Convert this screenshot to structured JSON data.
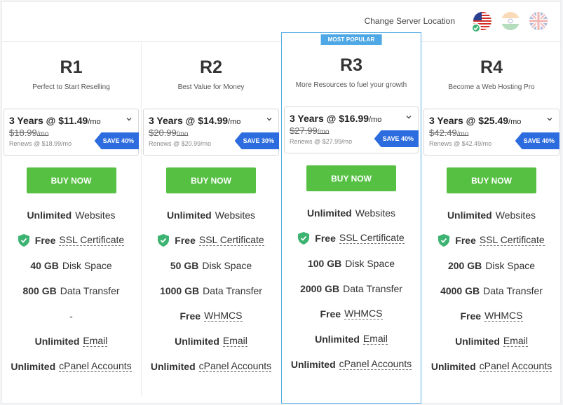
{
  "location": {
    "label": "Change Server Location",
    "flags": [
      {
        "name": "us-flag-icon",
        "selected": true
      },
      {
        "name": "india-flag-icon",
        "selected": false
      },
      {
        "name": "uk-flag-icon",
        "selected": false
      }
    ]
  },
  "plans": [
    {
      "name": "R1",
      "tagline": "Perfect to Start Reselling",
      "term": "3 Years @ $11.49",
      "per": "/mo",
      "old_price": "$18.99",
      "renews": "Renews @ $18.99/mo",
      "save": "SAVE 40%",
      "buy": "BUY NOW",
      "features": {
        "websites_bold": "Unlimited",
        "websites": "Websites",
        "ssl_bold": "Free",
        "ssl": "SSL Certificate",
        "disk_bold": "40 GB",
        "disk": "Disk Space",
        "transfer_bold": "800 GB",
        "transfer": "Data Transfer",
        "whmcs_bold": "",
        "whmcs": "-",
        "email_bold": "Unlimited",
        "email": "Email",
        "cpanel_bold": "Unlimited",
        "cpanel": "cPanel Accounts"
      }
    },
    {
      "name": "R2",
      "tagline": "Best Value for Money",
      "term": "3 Years @ $14.99",
      "per": "/mo",
      "old_price": "$20.99",
      "renews": "Renews @ $20.99/mo",
      "save": "SAVE 30%",
      "buy": "BUY NOW",
      "features": {
        "websites_bold": "Unlimited",
        "websites": "Websites",
        "ssl_bold": "Free",
        "ssl": "SSL Certificate",
        "disk_bold": "50 GB",
        "disk": "Disk Space",
        "transfer_bold": "1000 GB",
        "transfer": "Data Transfer",
        "whmcs_bold": "Free",
        "whmcs": "WHMCS",
        "email_bold": "Unlimited",
        "email": "Email",
        "cpanel_bold": "Unlimited",
        "cpanel": "cPanel Accounts"
      }
    },
    {
      "name": "R3",
      "tagline": "More Resources to fuel your growth",
      "popular": "MOST POPULAR",
      "term": "3 Years @ $16.99",
      "per": "/mo",
      "old_price": "$27.99",
      "renews": "Renews @ $27.99/mo",
      "save": "SAVE 40%",
      "buy": "BUY NOW",
      "features": {
        "websites_bold": "Unlimited",
        "websites": "Websites",
        "ssl_bold": "Free",
        "ssl": "SSL Certificate",
        "disk_bold": "100 GB",
        "disk": "Disk Space",
        "transfer_bold": "2000 GB",
        "transfer": "Data Transfer",
        "whmcs_bold": "Free",
        "whmcs": "WHMCS",
        "email_bold": "Unlimited",
        "email": "Email",
        "cpanel_bold": "Unlimited",
        "cpanel": "cPanel Accounts"
      }
    },
    {
      "name": "R4",
      "tagline": "Become a Web Hosting Pro",
      "term": "3 Years @ $25.49",
      "per": "/mo",
      "old_price": "$42.49",
      "renews": "Renews @ $42.49/mo",
      "save": "SAVE 40%",
      "buy": "BUY NOW",
      "features": {
        "websites_bold": "Unlimited",
        "websites": "Websites",
        "ssl_bold": "Free",
        "ssl": "SSL Certificate",
        "disk_bold": "200 GB",
        "disk": "Disk Space",
        "transfer_bold": "4000 GB",
        "transfer": "Data Transfer",
        "whmcs_bold": "Free",
        "whmcs": "WHMCS",
        "email_bold": "Unlimited",
        "email": "Email",
        "cpanel_bold": "Unlimited",
        "cpanel": "cPanel Accounts"
      }
    }
  ],
  "colors": {
    "buy_green": "#56c043",
    "save_blue": "#2d6cdf",
    "featured_border": "#5aaee6",
    "shield_green": "#3cb371"
  }
}
